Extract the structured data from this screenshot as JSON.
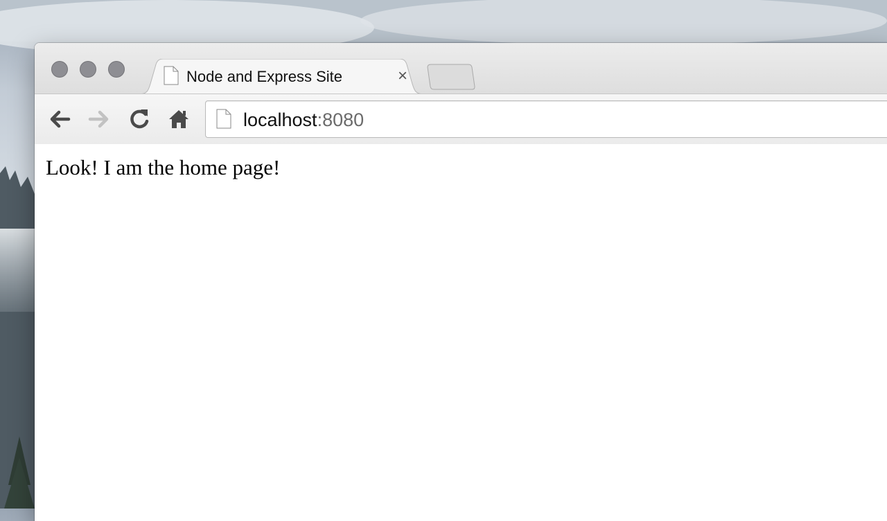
{
  "tab": {
    "title": "Node and Express Site",
    "close_glyph": "×",
    "favicon": "page-icon"
  },
  "omnibox": {
    "icon": "page-icon",
    "host": "localhost",
    "port": ":8080"
  },
  "navigation": {
    "back": "arrow-left-icon",
    "forward": "arrow-right-icon",
    "reload": "reload-icon",
    "home": "home-icon"
  },
  "page": {
    "text": "Look! I am the home page!"
  },
  "colors": {
    "tabstrip": "#dedede",
    "toolbar": "#f0f0f0",
    "traffic_light": "#8e8e93",
    "port_text": "#6b6b6b"
  }
}
